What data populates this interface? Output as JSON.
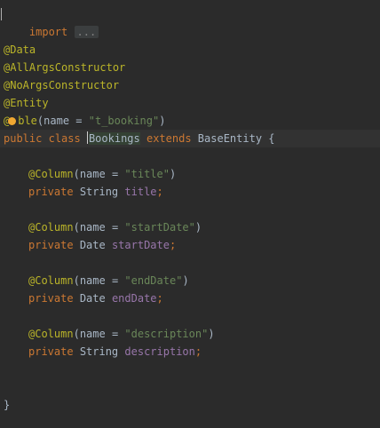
{
  "editor": {
    "language": "java",
    "lines": {
      "import_kw": "import",
      "import_folded": "...",
      "data_ann": "@Data",
      "allargs_ann": "@AllArgsConstructor",
      "noargs_ann": "@NoArgsConstructor",
      "entity_ann": "@Entity",
      "table_at": "@",
      "table_rest": "ble",
      "table_open": "(",
      "table_param": "name",
      "table_eq": " = ",
      "table_value": "\"t_booking\"",
      "table_close": ")",
      "class_public": "public",
      "class_class": "class",
      "class_name": "Bookings",
      "class_extends": "extends",
      "class_base": "BaseEntity",
      "class_brace": "{",
      "close_brace": "}"
    },
    "fields": [
      {
        "annotation": "@Column",
        "param": "name",
        "value": "\"title\"",
        "modifier": "private",
        "type": "String",
        "name": "title"
      },
      {
        "annotation": "@Column",
        "param": "name",
        "value": "\"startDate\"",
        "modifier": "private",
        "type": "Date",
        "name": "startDate"
      },
      {
        "annotation": "@Column",
        "param": "name",
        "value": "\"endDate\"",
        "modifier": "private",
        "type": "Date",
        "name": "endDate"
      },
      {
        "annotation": "@Column",
        "param": "name",
        "value": "\"description\"",
        "modifier": "private",
        "type": "String",
        "name": "description"
      }
    ],
    "icons": {
      "intention": "lightbulb-icon"
    },
    "colors": {
      "background": "#2b2b2b",
      "keyword": "#cc7832",
      "annotation": "#bbb529",
      "string": "#6a8759",
      "field": "#9876aa",
      "text": "#a9b7c6",
      "intention_bulb": "#f0a731"
    }
  }
}
